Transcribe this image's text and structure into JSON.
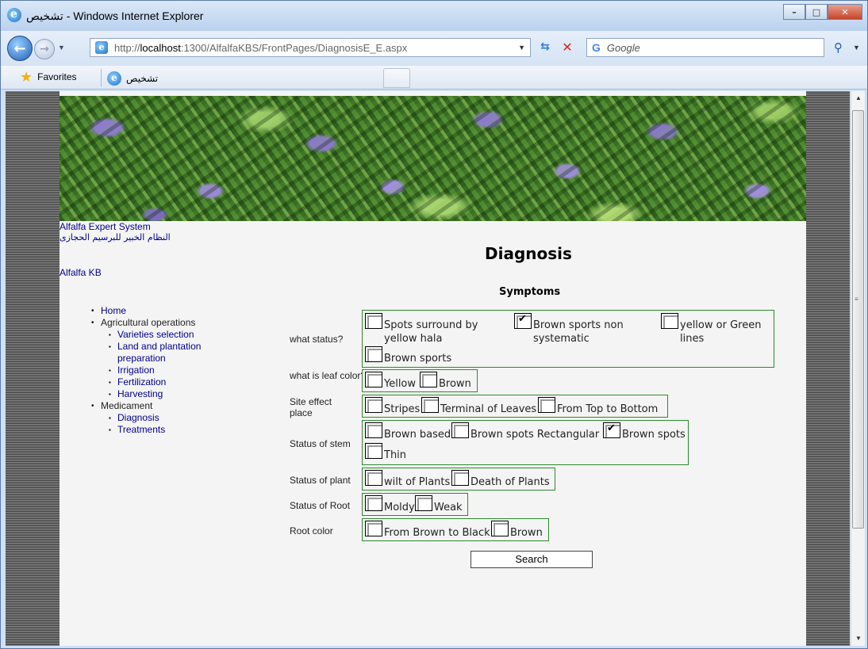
{
  "window": {
    "title": "تشخيص - Windows Internet Explorer",
    "min": "–",
    "max": "□",
    "close": "✕"
  },
  "nav": {
    "url_prefix": "http://",
    "url_host": "localhost",
    "url_rest": ":1300/AlfalfaKBS/FrontPages/DiagnosisE_E.aspx",
    "search_engine": "G",
    "search_placeholder": "Google"
  },
  "favorites": {
    "label": "Favorites"
  },
  "tab": {
    "title": "تشخيص"
  },
  "site": {
    "title_en": "Alfalfa Expert System",
    "title_ar": "النظام الخبير للبرسيم الحجازى",
    "kb_link": "Alfalfa KB"
  },
  "menu": {
    "home": "Home",
    "agri": "Agricultural operations",
    "agri_items": [
      "Varieties selection",
      "Land and plantation",
      "preparation",
      "Irrigation",
      "Fertilization",
      "Harvesting"
    ],
    "med": "Medicament",
    "med_items": [
      "Diagnosis",
      "Treatments"
    ]
  },
  "main": {
    "title": "Diagnosis",
    "subtitle": "Symptoms",
    "search_button": "Search"
  },
  "questions": [
    {
      "label": "what status?",
      "options": [
        {
          "text": "Spots surround by yellow hala",
          "checked": false
        },
        {
          "text": "Brown sports non systematic",
          "checked": true
        },
        {
          "text": "yellow or Green lines",
          "checked": false
        },
        {
          "text": "Brown sports",
          "checked": false
        }
      ]
    },
    {
      "label": "what is leaf color?",
      "options": [
        {
          "text": "Yellow",
          "checked": false
        },
        {
          "text": "Brown",
          "checked": false
        }
      ]
    },
    {
      "label": "Site effect place",
      "options": [
        {
          "text": "Stripes",
          "checked": false
        },
        {
          "text": "Terminal of Leaves",
          "checked": false
        },
        {
          "text": "From Top to Bottom",
          "checked": false
        }
      ]
    },
    {
      "label": "Status of stem",
      "options": [
        {
          "text": "Brown based",
          "checked": false
        },
        {
          "text": "Brown spots Rectangular",
          "checked": false
        },
        {
          "text": "Brown spots",
          "checked": true
        },
        {
          "text": "Thin",
          "checked": false
        }
      ]
    },
    {
      "label": "Status of plant",
      "options": [
        {
          "text": "wilt of Plants",
          "checked": false
        },
        {
          "text": "Death of Plants",
          "checked": false
        }
      ]
    },
    {
      "label": "Status of Root",
      "options": [
        {
          "text": "Moldy",
          "checked": false
        },
        {
          "text": "Weak",
          "checked": false
        }
      ]
    },
    {
      "label": "Root color",
      "options": [
        {
          "text": "From Brown to Black",
          "checked": false
        },
        {
          "text": "Brown",
          "checked": false
        }
      ]
    }
  ]
}
